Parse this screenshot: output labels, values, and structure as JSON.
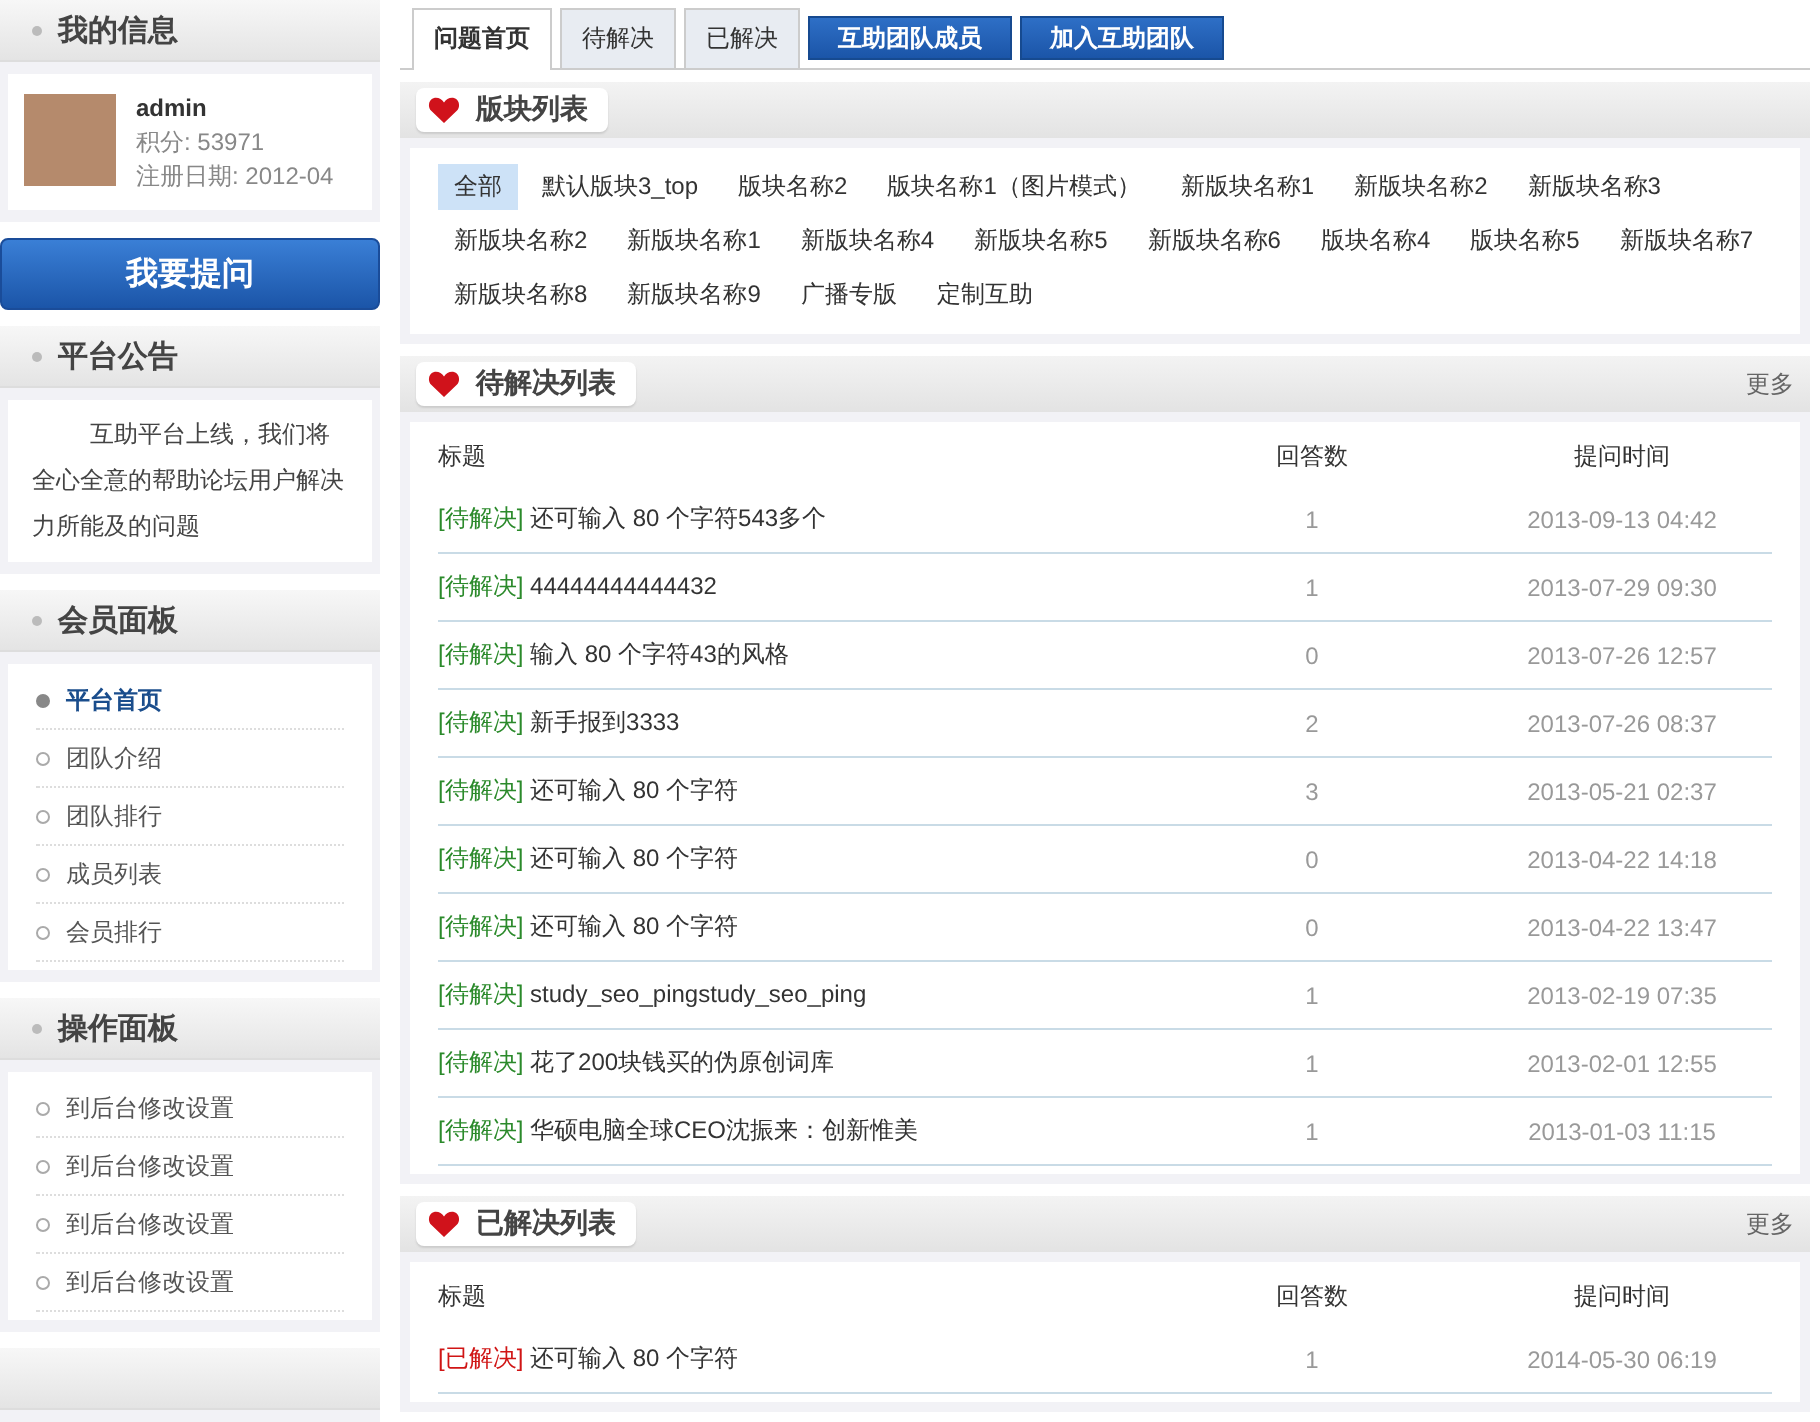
{
  "sidebar": {
    "profile": {
      "title": "我的信息",
      "username": "admin",
      "points": "积分: 53971",
      "registered": "注册日期: 2012-04"
    },
    "ask_button": "我要提问",
    "notice": {
      "title": "平台公告",
      "text": "互助平台上线，我们将全心全意的帮助论坛用户解决力所能及的问题"
    },
    "member_panel": {
      "title": "会员面板",
      "items": [
        {
          "label": "平台首页",
          "selected": true
        },
        {
          "label": "团队介绍",
          "selected": false
        },
        {
          "label": "团队排行",
          "selected": false
        },
        {
          "label": "成员列表",
          "selected": false
        },
        {
          "label": "会员排行",
          "selected": false
        }
      ]
    },
    "action_panel": {
      "title": "操作面板",
      "items": [
        {
          "label": "到后台修改设置"
        },
        {
          "label": "到后台修改设置"
        },
        {
          "label": "到后台修改设置"
        },
        {
          "label": "到后台修改设置"
        }
      ]
    }
  },
  "tabs": [
    {
      "label": "问题首页",
      "selected": true
    },
    {
      "label": "待解决",
      "selected": false
    },
    {
      "label": "已解决",
      "selected": false
    }
  ],
  "tab_buttons": [
    "互助团队成员",
    "加入互助团队"
  ],
  "sections": {
    "title": "版块列表",
    "items": [
      {
        "label": "全部",
        "selected": true
      },
      {
        "label": "默认版块3_top",
        "selected": false
      },
      {
        "label": "版块名称2",
        "selected": false
      },
      {
        "label": "版块名称1（图片模式）",
        "selected": false
      },
      {
        "label": "新版块名称1",
        "selected": false
      },
      {
        "label": "新版块名称2",
        "selected": false
      },
      {
        "label": "新版块名称3",
        "selected": false
      },
      {
        "label": "新版块名称2",
        "selected": false
      },
      {
        "label": "新版块名称1",
        "selected": false
      },
      {
        "label": "新版块名称4",
        "selected": false
      },
      {
        "label": "新版块名称5",
        "selected": false
      },
      {
        "label": "新版块名称6",
        "selected": false
      },
      {
        "label": "版块名称4",
        "selected": false
      },
      {
        "label": "版块名称5",
        "selected": false
      },
      {
        "label": "新版块名称7",
        "selected": false
      },
      {
        "label": "新版块名称8",
        "selected": false
      },
      {
        "label": "新版块名称9",
        "selected": false
      },
      {
        "label": "广播专版",
        "selected": false
      },
      {
        "label": "定制互助",
        "selected": false
      }
    ]
  },
  "lists": [
    {
      "title": "待解决列表",
      "more": "更多",
      "columns": [
        "标题",
        "回答数",
        "提问时间"
      ],
      "rows": [
        {
          "status": "[待解决]",
          "kind": "pending",
          "title": "还可输入 80 个字符543多个",
          "answers": "1",
          "time": "2013-09-13 04:42"
        },
        {
          "status": "[待解决]",
          "kind": "pending",
          "title": "44444444444432",
          "answers": "1",
          "time": "2013-07-29 09:30"
        },
        {
          "status": "[待解决]",
          "kind": "pending",
          "title": "输入 80 个字符43的风格",
          "answers": "0",
          "time": "2013-07-26 12:57"
        },
        {
          "status": "[待解决]",
          "kind": "pending",
          "title": "新手报到3333",
          "answers": "2",
          "time": "2013-07-26 08:37"
        },
        {
          "status": "[待解决]",
          "kind": "pending",
          "title": "还可输入 80 个字符",
          "answers": "3",
          "time": "2013-05-21 02:37"
        },
        {
          "status": "[待解决]",
          "kind": "pending",
          "title": "还可输入 80 个字符",
          "answers": "0",
          "time": "2013-04-22 14:18"
        },
        {
          "status": "[待解决]",
          "kind": "pending",
          "title": "还可输入 80 个字符",
          "answers": "0",
          "time": "2013-04-22 13:47"
        },
        {
          "status": "[待解决]",
          "kind": "pending",
          "title": "study_seo_pingstudy_seo_ping",
          "answers": "1",
          "time": "2013-02-19 07:35"
        },
        {
          "status": "[待解决]",
          "kind": "pending",
          "title": "花了200块钱买的伪原创词库",
          "answers": "1",
          "time": "2013-02-01 12:55"
        },
        {
          "status": "[待解决]",
          "kind": "pending",
          "title": "华硕电脑全球CEO沈振来：创新惟美",
          "answers": "1",
          "time": "2013-01-03 11:15"
        }
      ]
    },
    {
      "title": "已解决列表",
      "more": "更多",
      "columns": [
        "标题",
        "回答数",
        "提问时间"
      ],
      "rows": [
        {
          "status": "[已解决]",
          "kind": "solved",
          "title": "还可输入 80 个字符",
          "answers": "1",
          "time": "2014-05-30 06:19"
        }
      ]
    }
  ]
}
